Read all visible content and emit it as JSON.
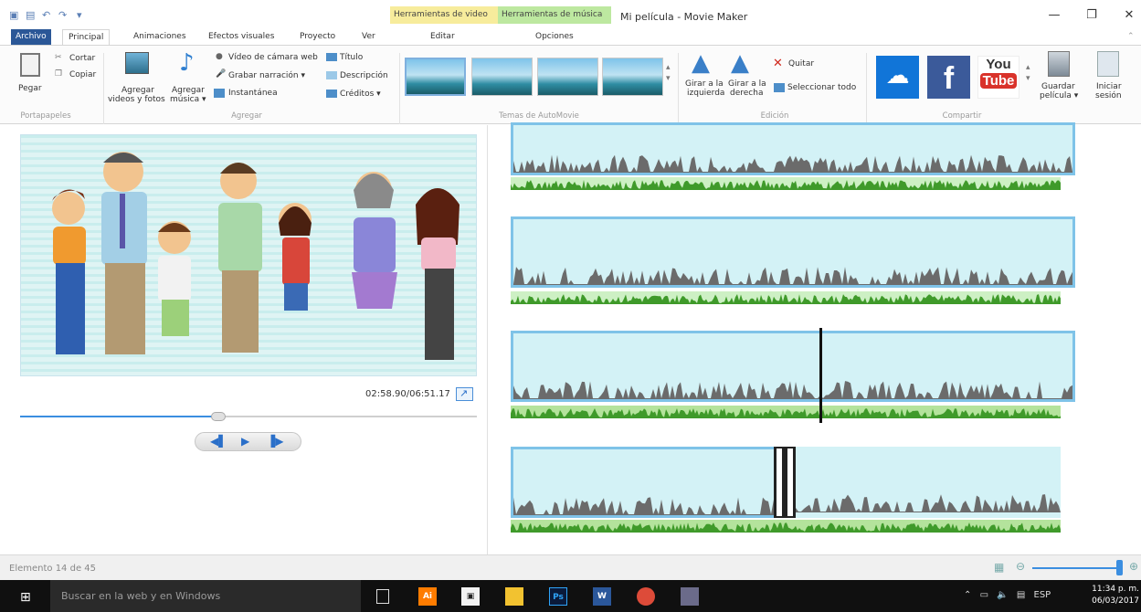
{
  "window": {
    "title": "Mi película - Movie Maker",
    "contextual_tabs": [
      "Herramientas de video",
      "Herramientas de música"
    ]
  },
  "tabs": [
    "Archivo",
    "Principal",
    "Animaciones",
    "Efectos visuales",
    "Proyecto",
    "Ver",
    "Editar",
    "Opciones"
  ],
  "ribbon": {
    "portapapeles": {
      "paste": "Pegar",
      "cut": "Cortar",
      "copy": "Copiar",
      "group": "Portapapeles"
    },
    "agregar": {
      "add_videos": [
        "Agregar",
        "videos y fotos"
      ],
      "add_music": [
        "Agregar",
        "música ▾"
      ],
      "webcam": "Vídeo de cámara web",
      "narration": "Grabar narración ▾",
      "snapshot": "Instantánea",
      "title": "Título",
      "caption": "Descripción",
      "credits": "Créditos ▾",
      "group": "Agregar"
    },
    "themes": {
      "group": "Temas de AutoMovie"
    },
    "edicion": {
      "rotate_left": [
        "Girar a la",
        "izquierda"
      ],
      "rotate_right": [
        "Girar a la",
        "derecha"
      ],
      "remove": "Quitar",
      "select_all": "Seleccionar todo",
      "group": "Edición"
    },
    "compartir": {
      "group": "Compartir",
      "save": [
        "Guardar",
        "película ▾"
      ],
      "signin": [
        "Iniciar",
        "sesión"
      ]
    }
  },
  "preview": {
    "timecode": "02:58.90/06:51.17",
    "progress": 0.434
  },
  "status": {
    "text": "Elemento 14 de 45",
    "zoom": 0.95
  },
  "taskbar": {
    "search_placeholder": "Buscar en la web y en Windows",
    "lang": "ESP",
    "time": "11:34 p. m.",
    "date": "06/03/2017"
  },
  "colors": {
    "accent": "#2b5797",
    "clip_border": "#7fc3e8",
    "audio": "#cdf0c4"
  }
}
